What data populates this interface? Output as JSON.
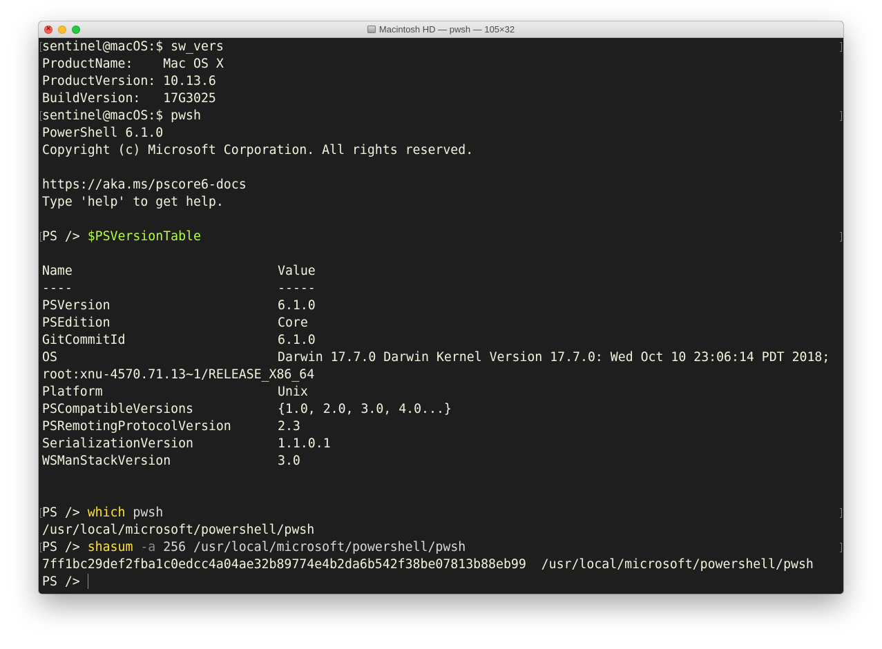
{
  "window": {
    "title": "Macintosh HD — pwsh — 105×32"
  },
  "terminal": {
    "sw_vers": {
      "prompt": "sentinel@macOS:$ sw_vers",
      "product_name": "ProductName:    Mac OS X",
      "product_version": "ProductVersion: 10.13.6",
      "build_version": "BuildVersion:   17G3025"
    },
    "pwsh_launch": {
      "prompt": "sentinel@macOS:$ pwsh",
      "version": "PowerShell 6.1.0",
      "copyright": "Copyright (c) Microsoft Corporation. All rights reserved.",
      "docs_url": "https://aka.ms/pscore6-docs",
      "help_hint": "Type 'help' to get help."
    },
    "ps_prompt": "PS />",
    "version_table_cmd": "$PSVersionTable",
    "version_table": {
      "header": {
        "name": "Name",
        "value": "Value"
      },
      "separator": {
        "name": "----",
        "value": "-----"
      },
      "rows": [
        {
          "name": "PSVersion",
          "value": "6.1.0"
        },
        {
          "name": "PSEdition",
          "value": "Core"
        },
        {
          "name": "GitCommitId",
          "value": "6.1.0"
        },
        {
          "name": "OS",
          "value": "Darwin 17.7.0 Darwin Kernel Version 17.7.0: Wed Oct 10 23:06:14 PDT 2018;"
        },
        {
          "name": "Platform",
          "value": "Unix"
        },
        {
          "name": "PSCompatibleVersions",
          "value": "{1.0, 2.0, 3.0, 4.0...}"
        },
        {
          "name": "PSRemotingProtocolVersion",
          "value": "2.3"
        },
        {
          "name": "SerializationVersion",
          "value": "1.1.0.1"
        },
        {
          "name": "WSManStackVersion",
          "value": "3.0"
        }
      ],
      "os_wrap": "root:xnu-4570.71.13~1/RELEASE_X86_64"
    },
    "which_cmd": {
      "keyword": "which",
      "arg": "pwsh"
    },
    "which_output": "/usr/local/microsoft/powershell/pwsh",
    "shasum_cmd": {
      "keyword": "shasum",
      "param": "-a",
      "num": "256",
      "path": "/usr/local/microsoft/powershell/pwsh"
    },
    "shasum_output": "7ff1bc29def2fba1c0edcc4a04ae32b89774e4b2da6b542f38be07813b88eb99  /usr/local/microsoft/powershell/pwsh",
    "colors": {
      "background": "#1e1e1e",
      "foreground": "#f3f3de",
      "variable": "#b4ff3c",
      "keyword": "#ffe034",
      "parameter": "#8a8a8a",
      "cursor": "#3ec83e"
    }
  }
}
